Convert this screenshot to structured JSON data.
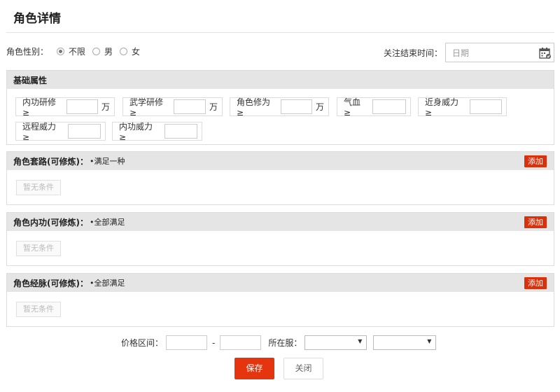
{
  "dialog": {
    "title": "角色详情"
  },
  "gender": {
    "label": "角色性别：",
    "options": [
      {
        "label": "不限",
        "checked": true
      },
      {
        "label": "男",
        "checked": false
      },
      {
        "label": "女",
        "checked": false
      }
    ]
  },
  "end_time": {
    "label": "关注结束时间：",
    "placeholder": "日期"
  },
  "basic": {
    "title": "基础属性",
    "fields": [
      {
        "label": "内功研修 ≥",
        "unit": "万"
      },
      {
        "label": "武学研修 ≥",
        "unit": "万"
      },
      {
        "label": "角色修为 ≥",
        "unit": "万"
      },
      {
        "label": "气血 ≥",
        "unit": ""
      },
      {
        "label": "近身威力 ≥",
        "unit": ""
      },
      {
        "label": "远程威力 ≥",
        "unit": ""
      },
      {
        "label": "内功威力 ≥",
        "unit": ""
      }
    ]
  },
  "conditions": [
    {
      "title": "角色套路(可修炼)：",
      "note": "•满足一种",
      "add_label": "添加",
      "empty_label": "暂无条件"
    },
    {
      "title": "角色内功(可修炼)：",
      "note": "•全部满足",
      "add_label": "添加",
      "empty_label": "暂无条件"
    },
    {
      "title": "角色经脉(可修炼)：",
      "note": "•全部满足",
      "add_label": "添加",
      "empty_label": "暂无条件"
    }
  ],
  "filters": {
    "price_label": "价格区间：",
    "price_sep": "-",
    "server_label": "所在服："
  },
  "actions": {
    "save_label": "保存",
    "close_label": "关闭"
  },
  "colors": {
    "accent": "#e4350e",
    "section_bg": "#e5e5e5"
  }
}
